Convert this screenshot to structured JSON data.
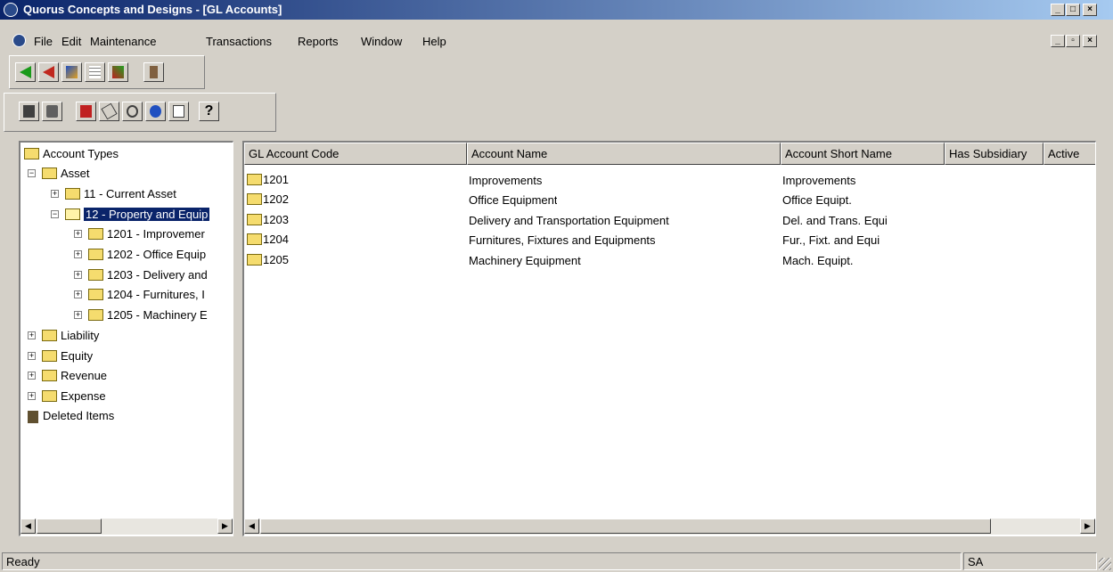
{
  "window": {
    "title": "Quorus Concepts and Designs - [GL Accounts]"
  },
  "menubar": {
    "items": [
      "File",
      "Edit",
      "Maintenance",
      "Transactions",
      "Reports",
      "Window",
      "Help"
    ]
  },
  "toolbar1": {
    "icons": [
      "back-arrow-icon",
      "forward-arrow-icon",
      "chart-icon",
      "grid-icon",
      "edit-pencil-icon",
      "exit-door-icon"
    ]
  },
  "toolbar2": {
    "icons": [
      "save-icon",
      "print-icon",
      "add-record-icon",
      "eraser-icon",
      "find-icon",
      "refresh-icon",
      "export-icon",
      "help-icon"
    ]
  },
  "tree": {
    "root": "Account Types",
    "asset": "Asset",
    "current_asset": "11 - Current Asset",
    "property": "12 - Property and Equip",
    "children": [
      "1201 - Improvemer",
      "1202 - Office Equip",
      "1203 - Delivery and",
      "1204 - Furnitures, I",
      "1205 - Machinery E"
    ],
    "others": [
      "Liability",
      "Equity",
      "Revenue",
      "Expense"
    ],
    "deleted": "Deleted Items"
  },
  "list": {
    "columns": [
      "GL Account Code",
      "Account Name",
      "Account Short Name",
      "Has Subsidiary",
      "Active"
    ],
    "rows": [
      {
        "code": "1201",
        "name": "Improvements",
        "short": "Improvements"
      },
      {
        "code": "1202",
        "name": "Office Equipment",
        "short": "Office Equipt."
      },
      {
        "code": "1203",
        "name": "Delivery and Transportation Equipment",
        "short": "Del. and Trans. Equi"
      },
      {
        "code": "1204",
        "name": "Furnitures, Fixtures and Equipments",
        "short": "Fur., Fixt. and Equi"
      },
      {
        "code": "1205",
        "name": "Machinery Equipment",
        "short": "Mach. Equipt."
      }
    ]
  },
  "status": {
    "text": "Ready",
    "user": "SA"
  },
  "colors": {
    "title_start": "#0a246a",
    "title_end": "#a6caf0",
    "selection": "#0a246a",
    "folder": "#f5dc6e"
  }
}
